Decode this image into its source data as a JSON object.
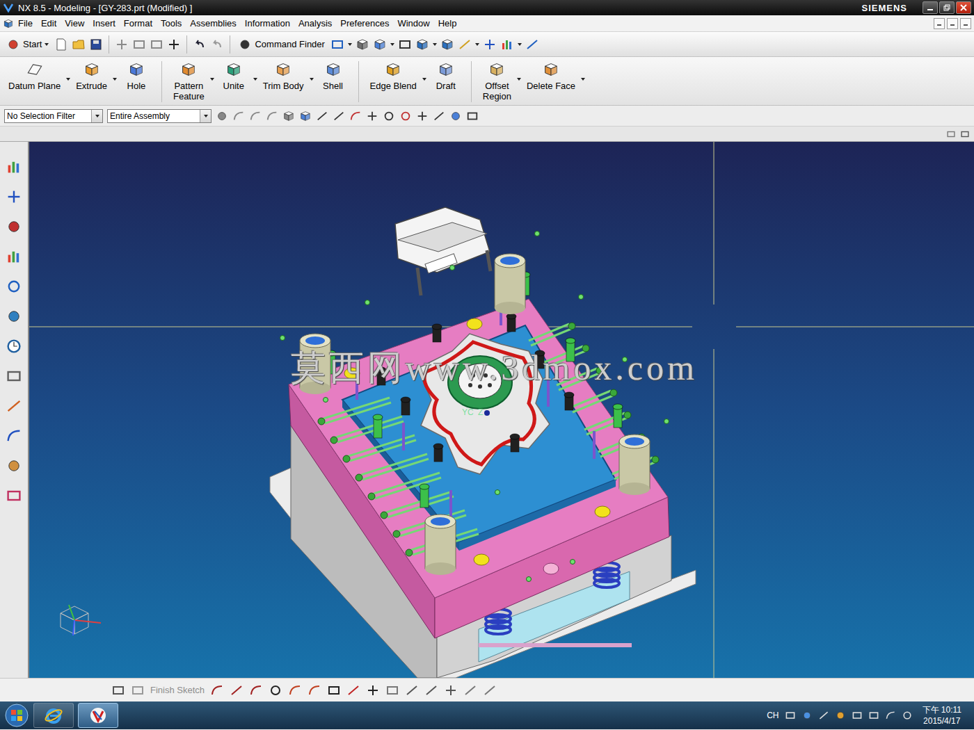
{
  "window": {
    "title": "NX 8.5 - Modeling - [GY-283.prt (Modified) ]",
    "brand": "SIEMENS"
  },
  "menu": [
    "File",
    "Edit",
    "View",
    "Insert",
    "Format",
    "Tools",
    "Assemblies",
    "Information",
    "Analysis",
    "Preferences",
    "Window",
    "Help"
  ],
  "standard_toolbar": {
    "start": "Start",
    "command_finder": "Command Finder"
  },
  "feature_toolbar": [
    {
      "lines": [
        "Datum Plane"
      ],
      "dropdown": true,
      "separator_after": false
    },
    {
      "lines": [
        "Extrude"
      ],
      "dropdown": true,
      "separator_after": false
    },
    {
      "lines": [
        "Hole"
      ],
      "dropdown": false,
      "separator_after": true
    },
    {
      "lines": [
        "Pattern",
        "Feature"
      ],
      "dropdown": true,
      "separator_after": false
    },
    {
      "lines": [
        "Unite"
      ],
      "dropdown": true,
      "separator_after": false
    },
    {
      "lines": [
        "Trim Body"
      ],
      "dropdown": true,
      "separator_after": false
    },
    {
      "lines": [
        "Shell"
      ],
      "dropdown": false,
      "separator_after": true
    },
    {
      "lines": [
        "Edge Blend"
      ],
      "dropdown": true,
      "separator_after": false
    },
    {
      "lines": [
        "Draft"
      ],
      "dropdown": false,
      "separator_after": true
    },
    {
      "lines": [
        "Offset",
        "Region"
      ],
      "dropdown": true,
      "separator_after": false
    },
    {
      "lines": [
        "Delete Face"
      ],
      "dropdown": true,
      "separator_after": false
    }
  ],
  "selection_bar": {
    "filter": "No Selection Filter",
    "scope": "Entire Assembly"
  },
  "graphics": {
    "watermark": "莫西网www.3dmox.com",
    "wcs_labels": [
      "YC",
      "Z"
    ]
  },
  "sketch_toolbar": {
    "finish_sketch": "Finish Sketch",
    "finish_sketch_disabled": true
  },
  "taskbar": {
    "language": "CH",
    "time": "下午 10:11",
    "date": "2015/4/17",
    "apps": [
      {
        "kind": "browser",
        "selected": false
      },
      {
        "kind": "nx",
        "selected": true
      }
    ]
  }
}
